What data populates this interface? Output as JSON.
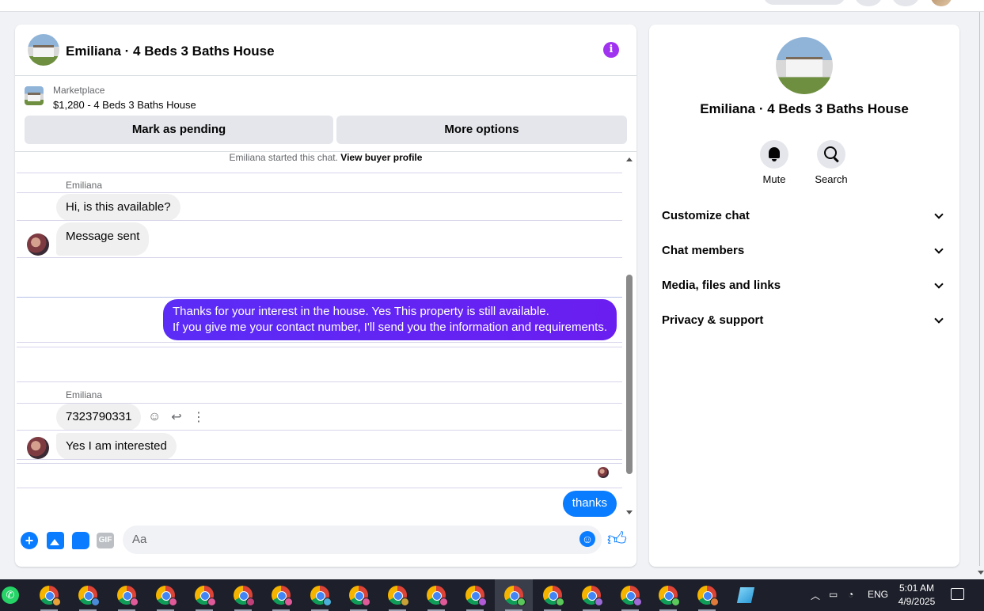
{
  "chat": {
    "title": "Emiliana · 4 Beds 3 Baths House",
    "listing": {
      "source": "Marketplace",
      "price_title": "$1,280 - 4 Beds 3 Baths House",
      "mark_pending_label": "Mark as pending",
      "more_options_label": "More options"
    },
    "system_note": "Emiliana started this chat.",
    "view_buyer_profile": "View buyer profile",
    "messages": [
      {
        "sender": "Emiliana",
        "text": "Hi, is this available?"
      },
      {
        "text": "Message sent"
      },
      {
        "line1": "Thanks for your interest in the house. Yes This property is still available.",
        "line2": "If you give me your contact number, I'll send you the information and requirements."
      },
      {
        "sender": "Emiliana",
        "text": "7323790331"
      },
      {
        "text": "Yes I am interested"
      },
      {
        "text": "thanks"
      }
    ],
    "composer": {
      "placeholder": "Aa",
      "gif_label": "GIF",
      "plus_glyph": "+"
    }
  },
  "info_panel": {
    "name": "Emiliana · 4 Beds 3 Baths House",
    "actions": [
      {
        "label": "Mute",
        "icon": "bell-icon"
      },
      {
        "label": "Search",
        "icon": "search-icon"
      }
    ],
    "sections": [
      "Customize chat",
      "Chat members",
      "Media, files and links",
      "Privacy & support"
    ]
  },
  "taskbar": {
    "language": "ENG",
    "time": "5:01 AM",
    "date": "4/9/2025",
    "chrome_profile_badges": [
      "#e8a23a",
      "#4a8ad6",
      "#e05a9a",
      "#e05a9a",
      "#e05a9a",
      "#c0417a",
      "#e05a9a",
      "#4aaed6",
      "#e05a9a",
      "#c8a236",
      "#e05a9a",
      "#b05ad6",
      "#5ac85a",
      "#5ac85a",
      "#9a6ad6",
      "#a06ad6",
      "#5ac85a",
      "#e07a3a"
    ]
  },
  "colors": {
    "accent_purple": "#6b27f4",
    "messenger_blue": "#0a7cff",
    "info_purple": "#a033f0"
  }
}
